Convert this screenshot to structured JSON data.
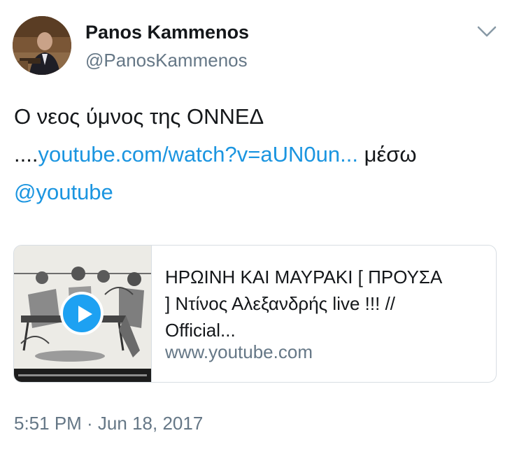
{
  "author": {
    "display_name": "Panos Kammenos",
    "handle": "@PanosKammenos",
    "avatar_icon": "profile-photo"
  },
  "menu": {
    "icon": "chevron-down-icon"
  },
  "tweet": {
    "text_line1": "Ο νεος ύμνος της ΟΝΝΕΔ",
    "text_prefix": "....",
    "link_text": "youtube.com/watch?v=aUN0un...",
    "via_text": " μέσω",
    "mention": "@youtube"
  },
  "card": {
    "title_line1": "ΗΡΩΙΝΗ ΚΑΙ ΜΑΥΡΑΚΙ [ ΠΡΟΥΣΑ",
    "title_line2": "] Ντίνος Αλεξανδρής live !!! //",
    "title_line3": "Official...",
    "domain": "www.youtube.com",
    "play_icon": "play-icon"
  },
  "timestamp": "5:51 PM · Jun 18, 2017",
  "colors": {
    "link": "#1b95e0",
    "secondary_text": "#657786",
    "play_button": "#1da1f2",
    "border": "#d8dee3"
  }
}
